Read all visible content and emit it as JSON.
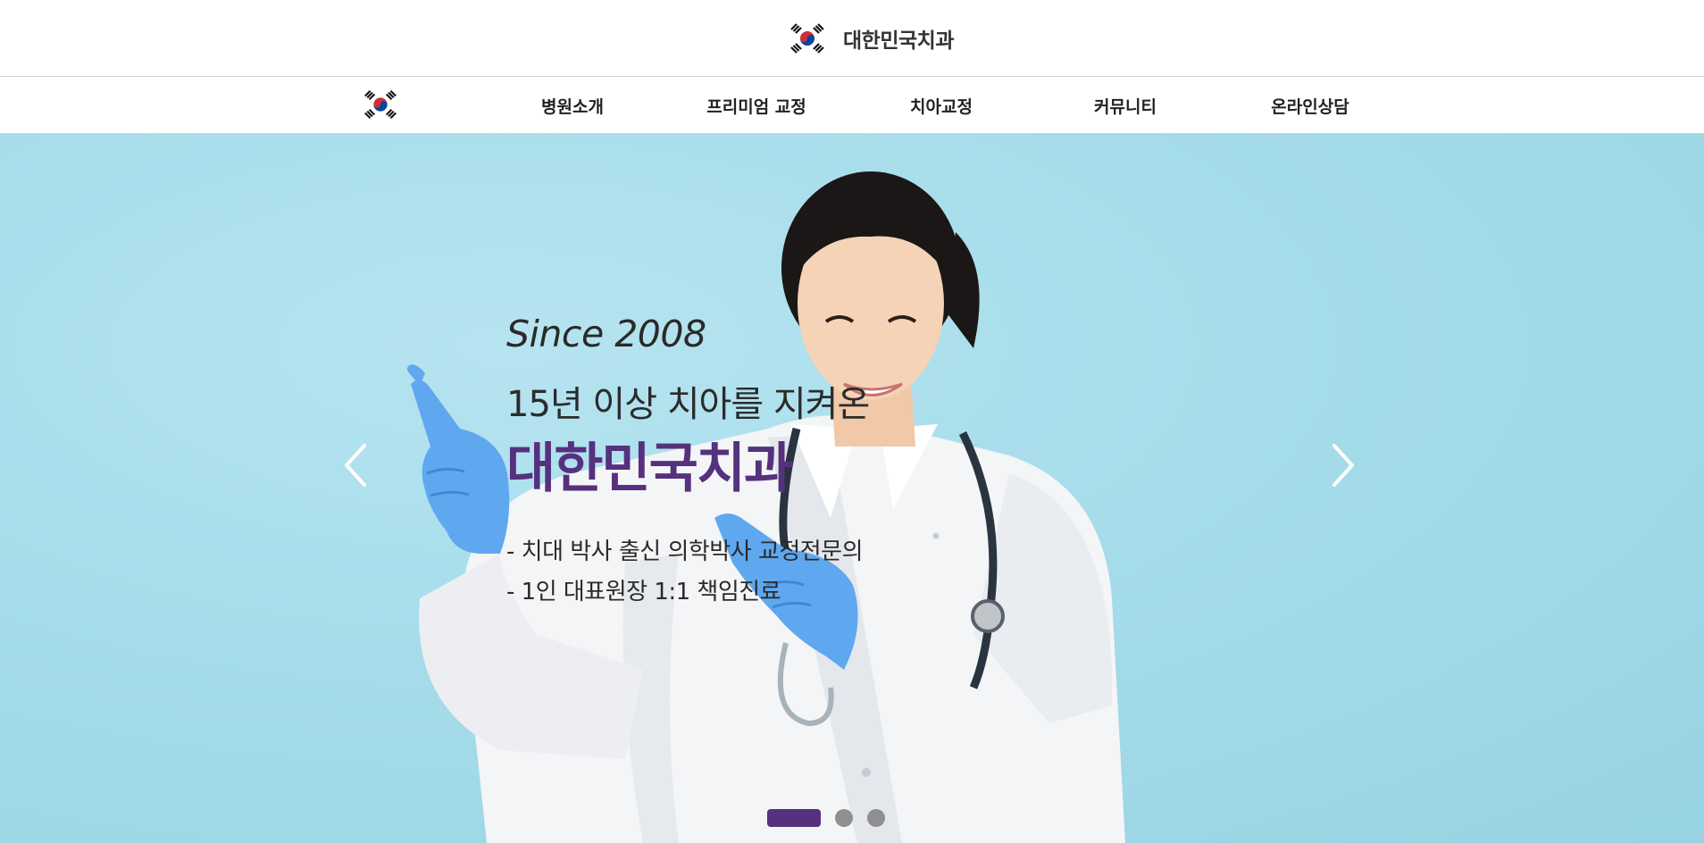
{
  "header": {
    "brand_name": "대한민국치과",
    "logo_icon": "korean-flag-icon"
  },
  "nav": {
    "logo_icon": "korean-flag-icon",
    "items": [
      {
        "label": "병원소개"
      },
      {
        "label": "프리미엄 교정"
      },
      {
        "label": "치아교정"
      },
      {
        "label": "커뮤니티"
      },
      {
        "label": "온라인상담"
      }
    ]
  },
  "hero": {
    "since": "Since 2008",
    "tagline": "15년 이상 치아를 지켜온",
    "title": "대한민국치과",
    "bullets": [
      "- 치대 박사 출신 의학박사 교정전문의",
      "- 1인 대표원장 1:1 책임진료"
    ],
    "prev_icon": "chevron-left-icon",
    "next_icon": "chevron-right-icon",
    "slide_count": 3,
    "active_slide": 1
  },
  "colors": {
    "accent": "#55317e",
    "hero_background": "#a6dcea",
    "glove": "#5fa8f0",
    "flag_red": "#cd2e3a",
    "flag_blue": "#0047a0"
  }
}
